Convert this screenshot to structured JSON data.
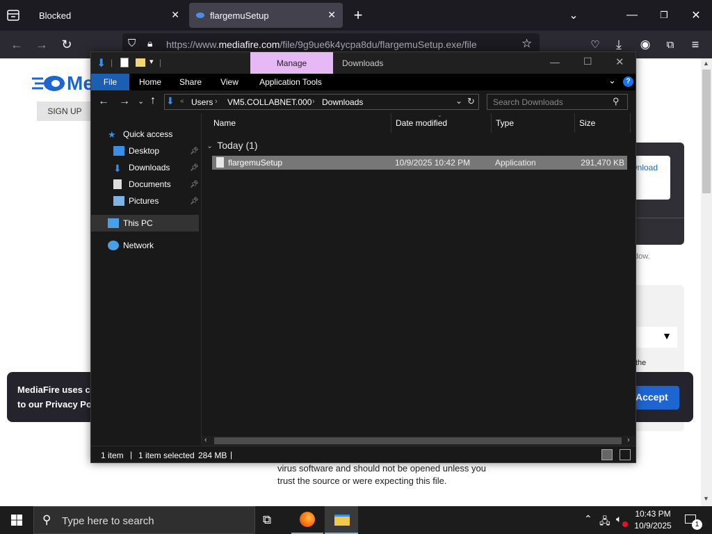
{
  "browser": {
    "tabs": [
      {
        "title": "Blocked"
      },
      {
        "title": "flargemuSetup"
      }
    ],
    "url_prefix": "https://www.",
    "url_domain": "mediafire.com",
    "url_path": "/file/9g9ue6k4ycpa8du/flargemuSetup.exe/file"
  },
  "webpage": {
    "logo_text": "Me",
    "signup_label": "SIGN UP",
    "download_fragment": "wnload",
    "shadow_fragment": "dow.",
    "the_fragment": "the",
    "cookie_text_line1": "MediaFire uses co",
    "cookie_text_line2": "to our Privacy Poli",
    "accept_label": "Accept",
    "warning_line1": "virus software and should not be opened unless you",
    "warning_line2": "trust the source or were expecting this file."
  },
  "explorer": {
    "context_tab": "Manage",
    "title": "Downloads",
    "ribbon_tabs": [
      "File",
      "Home",
      "Share",
      "View",
      "Application Tools"
    ],
    "breadcrumb": [
      "Users",
      "VM5.COLLABNET.000",
      "Downloads"
    ],
    "search_placeholder": "Search Downloads",
    "nav": {
      "quick_access": "Quick access",
      "items": [
        "Desktop",
        "Downloads",
        "Documents",
        "Pictures"
      ],
      "this_pc": "This PC",
      "network": "Network"
    },
    "columns": [
      "Name",
      "Date modified",
      "Type",
      "Size"
    ],
    "group_label": "Today (1)",
    "file": {
      "name": "flargemuSetup",
      "date": "10/9/2025 10:42 PM",
      "type": "Application",
      "size": "291,470 KB"
    },
    "status": {
      "count": "1 item",
      "selected": "1 item selected",
      "size": "284 MB"
    }
  },
  "taskbar": {
    "search_placeholder": "Type here to search",
    "time": "10:43 PM",
    "date": "10/9/2025",
    "notification_count": "1"
  },
  "colors": {
    "accent": "#0078d4",
    "manage_tab": "#e6b8f5",
    "selection": "#777777"
  }
}
